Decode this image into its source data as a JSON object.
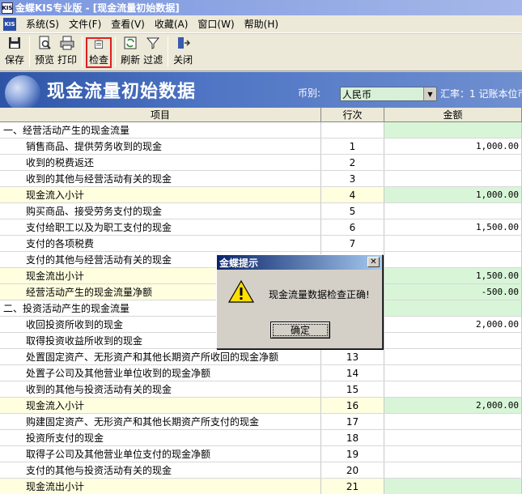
{
  "window": {
    "title": "金蝶KIS专业版 - [现金流量初始数据]",
    "app_icon_text": "KIS"
  },
  "menu": {
    "icon_text": "KIS",
    "items": [
      "系统(S)",
      "文件(F)",
      "查看(V)",
      "收藏(A)",
      "窗口(W)",
      "帮助(H)"
    ]
  },
  "toolbar": {
    "save": "保存",
    "preview": "预览",
    "print": "打印",
    "check": "检查",
    "refresh": "刷新",
    "filter": "过滤",
    "close": "关闭"
  },
  "banner": {
    "title": "现金流量初始数据",
    "currency_label": "币别:",
    "currency_value": "人民币",
    "rate_text": "汇率：1 记账本位币"
  },
  "table": {
    "headers": {
      "item": "项目",
      "line": "行次",
      "amount": "金额"
    },
    "rows": [
      {
        "item": "一、经营活动产生的现金流量",
        "line": "",
        "amount": "",
        "indent": false,
        "sub": false,
        "green": true
      },
      {
        "item": "销售商品、提供劳务收到的现金",
        "line": "1",
        "amount": "1,000.00",
        "indent": true,
        "sub": false,
        "green": false
      },
      {
        "item": "收到的税费返还",
        "line": "2",
        "amount": "",
        "indent": true,
        "sub": false,
        "green": false
      },
      {
        "item": "收到的其他与经营活动有关的现金",
        "line": "3",
        "amount": "",
        "indent": true,
        "sub": false,
        "green": false
      },
      {
        "item": "现金流入小计",
        "line": "4",
        "amount": "1,000.00",
        "indent": true,
        "sub": true,
        "green": true
      },
      {
        "item": "购买商品、接受劳务支付的现金",
        "line": "5",
        "amount": "",
        "indent": true,
        "sub": false,
        "green": false
      },
      {
        "item": "支付给职工以及为职工支付的现金",
        "line": "6",
        "amount": "1,500.00",
        "indent": true,
        "sub": false,
        "green": false
      },
      {
        "item": "支付的各项税费",
        "line": "7",
        "amount": "",
        "indent": true,
        "sub": false,
        "green": false
      },
      {
        "item": "支付的其他与经营活动有关的现金",
        "line": "",
        "amount": "",
        "indent": true,
        "sub": false,
        "green": false
      },
      {
        "item": "现金流出小计",
        "line": "",
        "amount": "1,500.00",
        "indent": true,
        "sub": true,
        "green": true
      },
      {
        "item": "经营活动产生的现金流量净额",
        "line": "",
        "amount": "-500.00",
        "indent": true,
        "sub": true,
        "green": true
      },
      {
        "item": "二、投资活动产生的现金流量",
        "line": "",
        "amount": "",
        "indent": false,
        "sub": false,
        "green": true
      },
      {
        "item": "收回投资所收到的现金",
        "line": "",
        "amount": "2,000.00",
        "indent": true,
        "sub": false,
        "green": false
      },
      {
        "item": "取得投资收益所收到的现金",
        "line": "",
        "amount": "",
        "indent": true,
        "sub": false,
        "green": false
      },
      {
        "item": "处置固定资产、无形资产和其他长期资产所收回的现金净额",
        "line": "13",
        "amount": "",
        "indent": true,
        "sub": false,
        "green": false
      },
      {
        "item": "处置子公司及其他营业单位收到的现金净额",
        "line": "14",
        "amount": "",
        "indent": true,
        "sub": false,
        "green": false
      },
      {
        "item": "收到的其他与投资活动有关的现金",
        "line": "15",
        "amount": "",
        "indent": true,
        "sub": false,
        "green": false
      },
      {
        "item": "现金流入小计",
        "line": "16",
        "amount": "2,000.00",
        "indent": true,
        "sub": true,
        "green": true
      },
      {
        "item": "购建固定资产、无形资产和其他长期资产所支付的现金",
        "line": "17",
        "amount": "",
        "indent": true,
        "sub": false,
        "green": false
      },
      {
        "item": "投资所支付的现金",
        "line": "18",
        "amount": "",
        "indent": true,
        "sub": false,
        "green": false
      },
      {
        "item": "取得子公司及其他营业单位支付的现金净额",
        "line": "19",
        "amount": "",
        "indent": true,
        "sub": false,
        "green": false
      },
      {
        "item": "支付的其他与投资活动有关的现金",
        "line": "20",
        "amount": "",
        "indent": true,
        "sub": false,
        "green": false
      },
      {
        "item": "现金流出小计",
        "line": "21",
        "amount": "",
        "indent": true,
        "sub": true,
        "green": true
      }
    ]
  },
  "dialog": {
    "title": "金蝶提示",
    "message": "现金流量数据检查正确!",
    "ok": "确定"
  }
}
